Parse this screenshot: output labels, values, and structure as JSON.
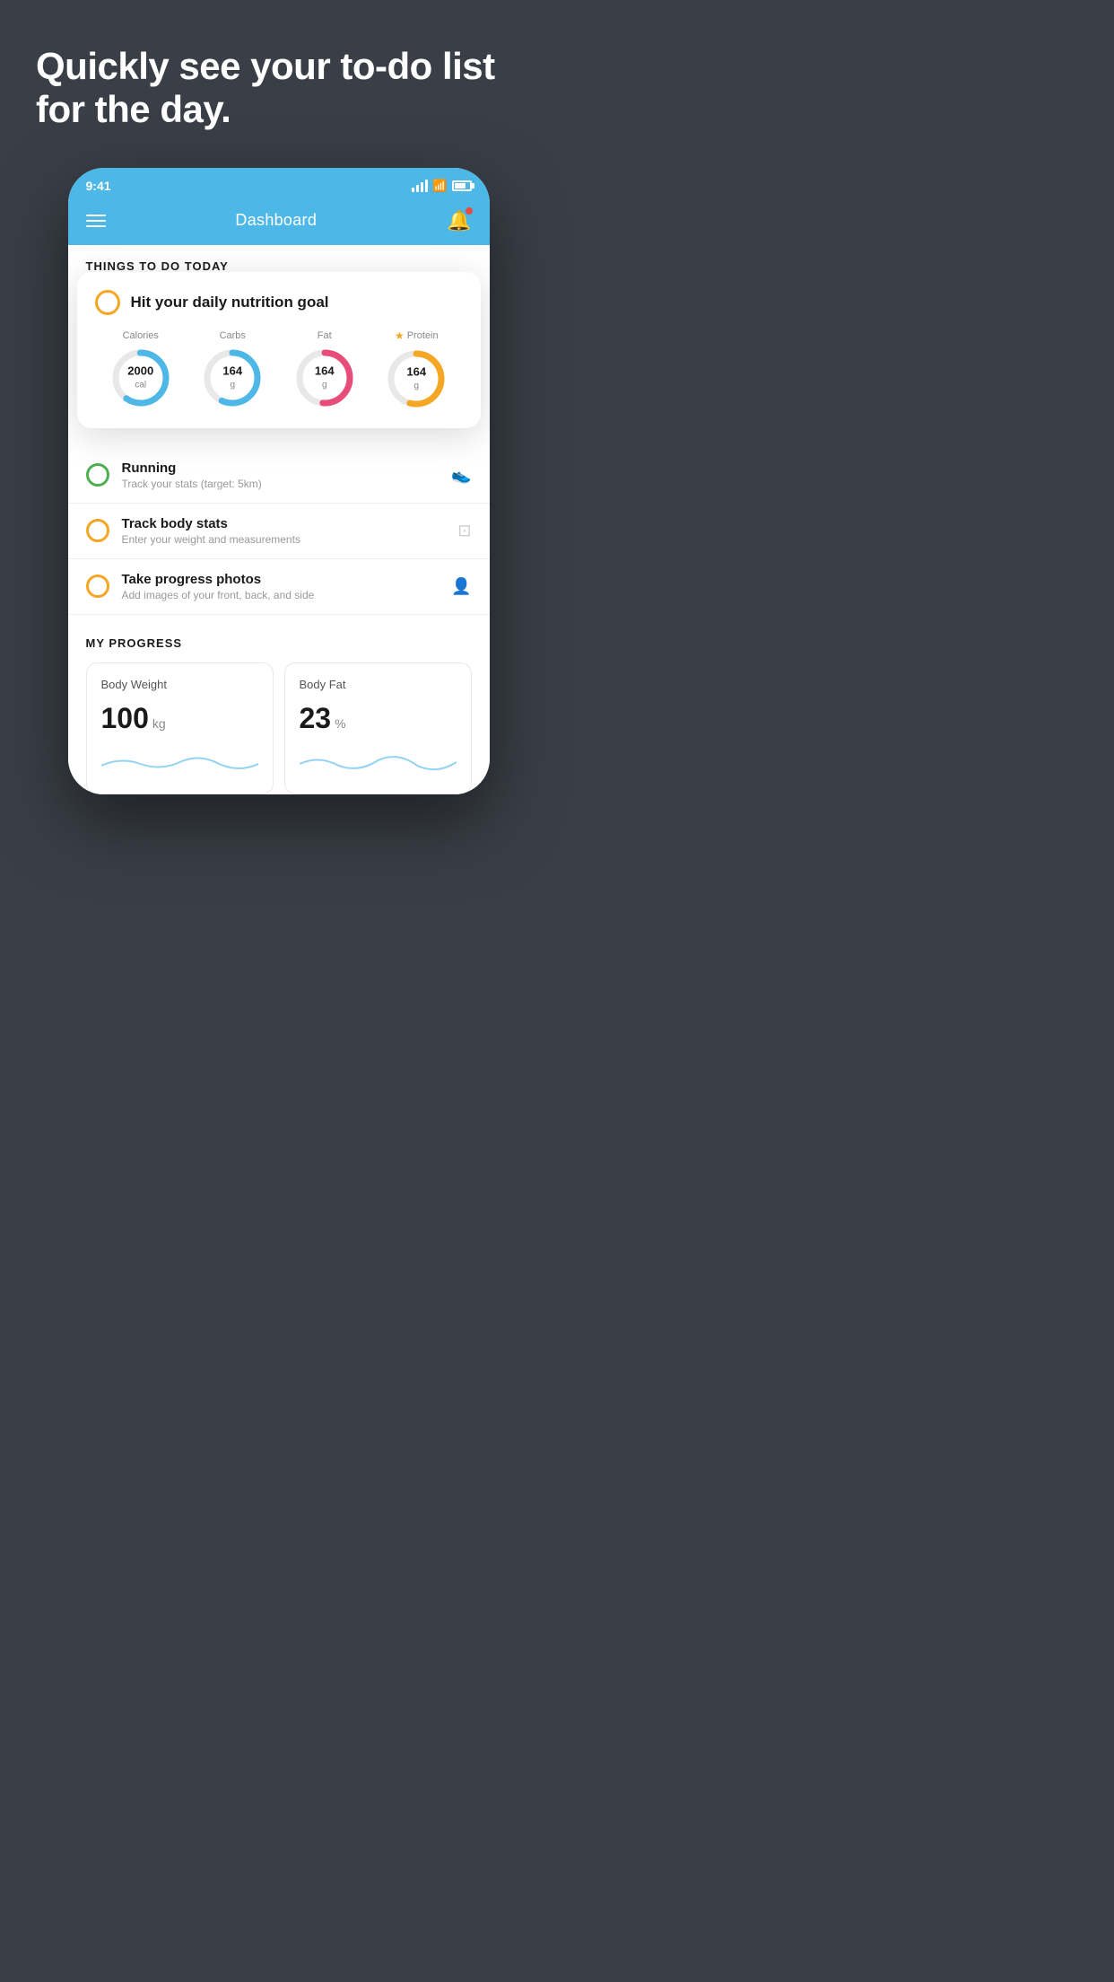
{
  "hero": {
    "title": "Quickly see your to-do list for the day."
  },
  "statusBar": {
    "time": "9:41"
  },
  "navbar": {
    "title": "Dashboard"
  },
  "thingsToDo": {
    "sectionHeader": "THINGS TO DO TODAY"
  },
  "nutritionCard": {
    "checkType": "circle",
    "title": "Hit your daily nutrition goal",
    "items": [
      {
        "label": "Calories",
        "value": "2000",
        "unit": "cal",
        "color": "blue",
        "starred": false
      },
      {
        "label": "Carbs",
        "value": "164",
        "unit": "g",
        "color": "blue",
        "starred": false
      },
      {
        "label": "Fat",
        "value": "164",
        "unit": "g",
        "color": "pink",
        "starred": false
      },
      {
        "label": "Protein",
        "value": "164",
        "unit": "g",
        "color": "yellow",
        "starred": true
      }
    ]
  },
  "listItems": [
    {
      "title": "Running",
      "subtitle": "Track your stats (target: 5km)",
      "circleColor": "green",
      "icon": "shoe"
    },
    {
      "title": "Track body stats",
      "subtitle": "Enter your weight and measurements",
      "circleColor": "yellow",
      "icon": "scale"
    },
    {
      "title": "Take progress photos",
      "subtitle": "Add images of your front, back, and side",
      "circleColor": "yellow",
      "icon": "person"
    }
  ],
  "progress": {
    "sectionHeader": "MY PROGRESS",
    "cards": [
      {
        "title": "Body Weight",
        "value": "100",
        "unit": "kg"
      },
      {
        "title": "Body Fat",
        "value": "23",
        "unit": "%"
      }
    ]
  }
}
